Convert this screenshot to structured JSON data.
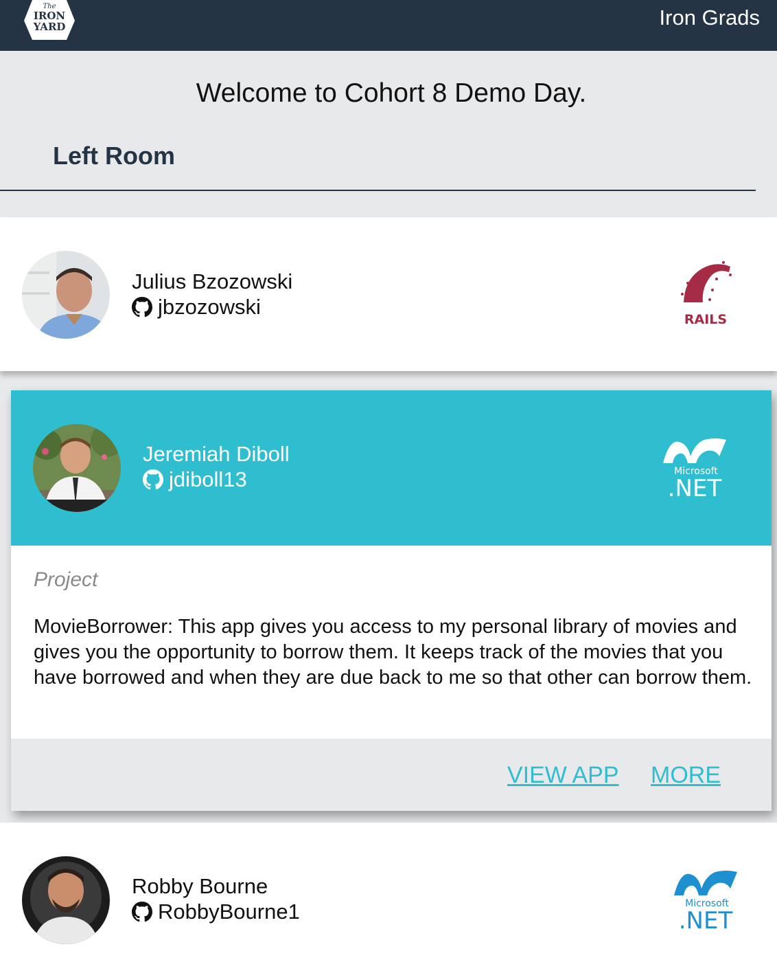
{
  "header": {
    "logo": {
      "line1": "The",
      "line2": "IRON",
      "line3": "YARD"
    },
    "site_title": "Iron Grads"
  },
  "welcome_text": "Welcome to Cohort 8 Demo Day.",
  "room_title": "Left Room",
  "graduates": [
    {
      "name": "Julius Bzozowski",
      "github": "jbzozowski",
      "tech": "Rails",
      "tech_label": "RAILS"
    },
    {
      "name": "Jeremiah Diboll",
      "github": "jdiboll13",
      "tech": ".NET",
      "tech_label_top": "Microsoft",
      "tech_label_main": ".NET",
      "expanded": true,
      "project_label": "Project",
      "project_description": "MovieBorrower: This app gives you access to my personal library of movies and gives you the opportunity to borrow them. It keeps track of the movies that you have borrowed and when they are due back to me so that other can borrow them.",
      "actions": {
        "view_app": "VIEW APP",
        "more": "MORE"
      }
    },
    {
      "name": "Robby Bourne",
      "github": "RobbyBourne1",
      "tech": ".NET",
      "tech_label_top": "Microsoft",
      "tech_label_main": ".NET"
    }
  ],
  "colors": {
    "header_bg": "#243444",
    "accent_teal": "#2fbecf",
    "rails_red": "#a62c46",
    "dotnet_blue": "#1e8fcf",
    "page_bg": "#e8e9eb"
  }
}
